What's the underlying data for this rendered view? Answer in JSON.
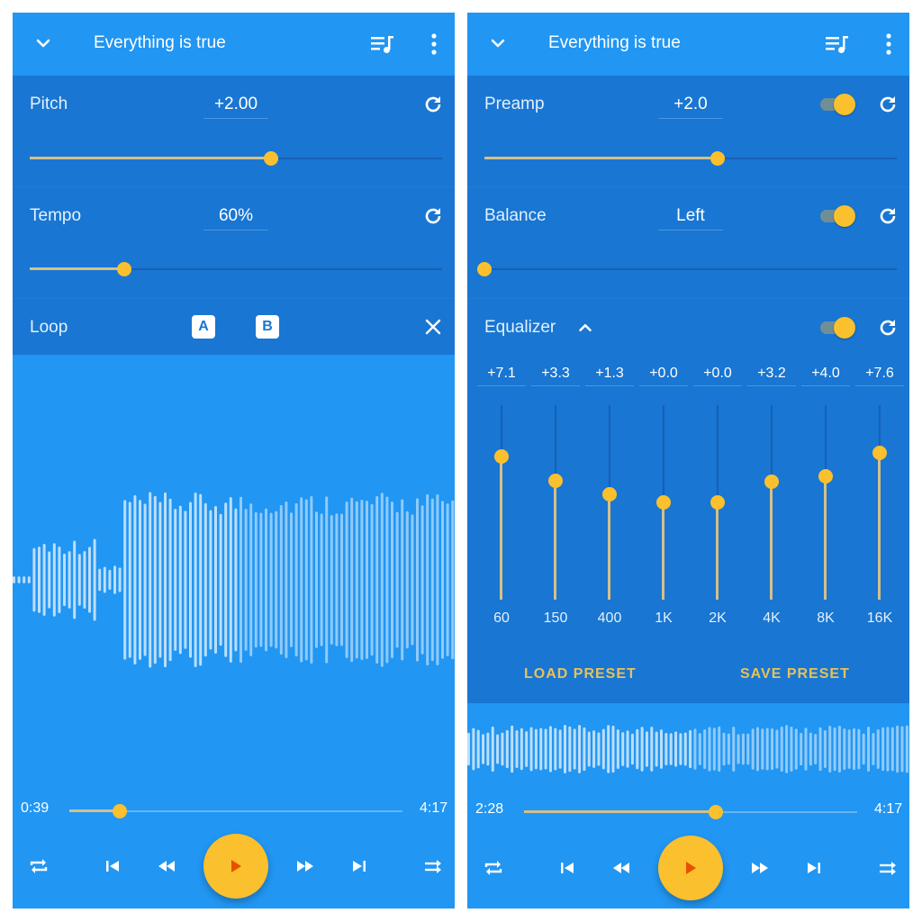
{
  "colors": {
    "primary": "#2196f3",
    "panel": "#1976d2",
    "accent": "#fbc02d",
    "accent_fill": "#d4c08a",
    "play_icon": "#e65100",
    "wave_played": "#bbdefb",
    "wave_unplayed": "#90caf9"
  },
  "left": {
    "appbar": {
      "title": "Everything is true",
      "icons": [
        "chevron-down-icon",
        "queue-music-icon",
        "more-vert-icon"
      ]
    },
    "pitch": {
      "label": "Pitch",
      "value": "+2.00",
      "slider_fraction": 0.585,
      "reset_icon": "refresh-icon"
    },
    "tempo": {
      "label": "Tempo",
      "value": "60%",
      "slider_fraction": 0.23,
      "reset_icon": "refresh-icon"
    },
    "loop": {
      "label": "Loop",
      "a_label": "A",
      "b_label": "B",
      "close_icon": "close-icon"
    },
    "waveform": {
      "played_fraction": 0.505
    },
    "player": {
      "elapsed": "0:39",
      "total": "4:17",
      "progress_fraction": 0.152,
      "controls": [
        "repeat-icon",
        "skip-previous-icon",
        "rewind-icon",
        "play-icon",
        "fast-forward-icon",
        "skip-next-icon",
        "shuffle-icon"
      ]
    }
  },
  "right": {
    "appbar": {
      "title": "Everything is true",
      "icons": [
        "chevron-down-icon",
        "queue-music-icon",
        "more-vert-icon"
      ]
    },
    "preamp": {
      "label": "Preamp",
      "value": "+2.0",
      "enabled": true,
      "slider_fraction": 0.565,
      "reset_icon": "refresh-icon"
    },
    "balance": {
      "label": "Balance",
      "value": "Left",
      "enabled": true,
      "slider_fraction": 0.0,
      "reset_icon": "refresh-icon"
    },
    "equalizer": {
      "label": "Equalizer",
      "expanded": true,
      "enabled": true,
      "range_db": [
        -15,
        15
      ],
      "bands": [
        {
          "freq": "60",
          "value": "+7.1",
          "db": 7.1
        },
        {
          "freq": "150",
          "value": "+3.3",
          "db": 3.3
        },
        {
          "freq": "400",
          "value": "+1.3",
          "db": 1.3
        },
        {
          "freq": "1K",
          "value": "+0.0",
          "db": 0.0
        },
        {
          "freq": "2K",
          "value": "+0.0",
          "db": 0.0
        },
        {
          "freq": "4K",
          "value": "+3.2",
          "db": 3.2
        },
        {
          "freq": "8K",
          "value": "+4.0",
          "db": 4.0
        },
        {
          "freq": "16K",
          "value": "+7.6",
          "db": 7.6
        }
      ],
      "load_preset": "LOAD PRESET",
      "save_preset": "SAVE PRESET"
    },
    "waveform": {
      "played_fraction": 0.51
    },
    "player": {
      "elapsed": "2:28",
      "total": "4:17",
      "progress_fraction": 0.575,
      "controls": [
        "repeat-icon",
        "skip-previous-icon",
        "rewind-icon",
        "play-icon",
        "fast-forward-icon",
        "skip-next-icon",
        "shuffle-icon"
      ]
    }
  }
}
